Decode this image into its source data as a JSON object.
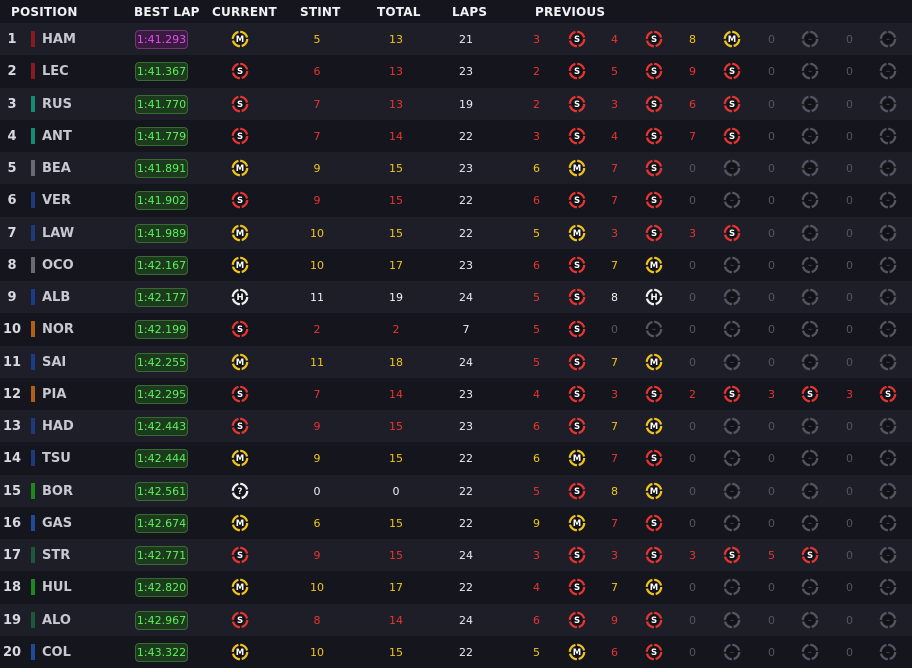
{
  "headers": {
    "position": "POSITION",
    "best_lap": "BEST LAP",
    "current": "CURRENT",
    "stint": "STINT",
    "total": "TOTAL",
    "laps": "LAPS",
    "previous": "PREVIOUS"
  },
  "colors": {
    "soft": "#e8342e",
    "medium": "#f0c419",
    "hard": "#f0f0f0",
    "unknown": "#f0f0f0",
    "empty": "#55555f",
    "lap_green": "#5cf05c",
    "lap_purple": "#e050e8"
  },
  "tyre_letters": {
    "soft": "S",
    "medium": "M",
    "hard": "H",
    "unknown": "?",
    "empty": "–"
  },
  "rows": [
    {
      "pos": "1",
      "driver": "HAM",
      "team_color": "#8a1a22",
      "best_lap": "1:41.293",
      "purple": true,
      "current": "medium",
      "stint": "5",
      "total": "13",
      "laps": "21",
      "stint_color": "medium",
      "previous": [
        [
          "3",
          "soft"
        ],
        [
          "4",
          "soft"
        ],
        [
          "8",
          "medium"
        ],
        [
          "0",
          "empty"
        ],
        [
          "0",
          "empty"
        ]
      ]
    },
    {
      "pos": "2",
      "driver": "LEC",
      "team_color": "#8a1a22",
      "best_lap": "1:41.367",
      "purple": false,
      "current": "soft",
      "stint": "6",
      "total": "13",
      "laps": "23",
      "stint_color": "soft",
      "previous": [
        [
          "2",
          "soft"
        ],
        [
          "5",
          "soft"
        ],
        [
          "9",
          "soft"
        ],
        [
          "0",
          "empty"
        ],
        [
          "0",
          "empty"
        ]
      ]
    },
    {
      "pos": "3",
      "driver": "RUS",
      "team_color": "#178a72",
      "best_lap": "1:41.770",
      "purple": false,
      "current": "soft",
      "stint": "7",
      "total": "13",
      "laps": "19",
      "stint_color": "soft",
      "previous": [
        [
          "2",
          "soft"
        ],
        [
          "3",
          "soft"
        ],
        [
          "6",
          "soft"
        ],
        [
          "0",
          "empty"
        ],
        [
          "0",
          "empty"
        ]
      ]
    },
    {
      "pos": "4",
      "driver": "ANT",
      "team_color": "#178a72",
      "best_lap": "1:41.779",
      "purple": false,
      "current": "soft",
      "stint": "7",
      "total": "14",
      "laps": "22",
      "stint_color": "soft",
      "previous": [
        [
          "3",
          "soft"
        ],
        [
          "4",
          "soft"
        ],
        [
          "7",
          "soft"
        ],
        [
          "0",
          "empty"
        ],
        [
          "0",
          "empty"
        ]
      ]
    },
    {
      "pos": "5",
      "driver": "BEA",
      "team_color": "#6a6a72",
      "best_lap": "1:41.891",
      "purple": false,
      "current": "medium",
      "stint": "9",
      "total": "15",
      "laps": "23",
      "stint_color": "medium",
      "previous": [
        [
          "6",
          "medium"
        ],
        [
          "7",
          "soft"
        ],
        [
          "0",
          "empty"
        ],
        [
          "0",
          "empty"
        ],
        [
          "0",
          "empty"
        ]
      ]
    },
    {
      "pos": "6",
      "driver": "VER",
      "team_color": "#1e3a7a",
      "best_lap": "1:41.902",
      "purple": false,
      "current": "soft",
      "stint": "9",
      "total": "15",
      "laps": "22",
      "stint_color": "soft",
      "previous": [
        [
          "6",
          "soft"
        ],
        [
          "7",
          "soft"
        ],
        [
          "0",
          "empty"
        ],
        [
          "0",
          "empty"
        ],
        [
          "0",
          "empty"
        ]
      ]
    },
    {
      "pos": "7",
      "driver": "LAW",
      "team_color": "#1e3a7a",
      "best_lap": "1:41.989",
      "purple": false,
      "current": "medium",
      "stint": "10",
      "total": "15",
      "laps": "22",
      "stint_color": "medium",
      "previous": [
        [
          "5",
          "medium"
        ],
        [
          "3",
          "soft"
        ],
        [
          "3",
          "soft"
        ],
        [
          "0",
          "empty"
        ],
        [
          "0",
          "empty"
        ]
      ]
    },
    {
      "pos": "8",
      "driver": "OCO",
      "team_color": "#6a6a72",
      "best_lap": "1:42.167",
      "purple": false,
      "current": "medium",
      "stint": "10",
      "total": "17",
      "laps": "23",
      "stint_color": "medium",
      "previous": [
        [
          "6",
          "soft"
        ],
        [
          "7",
          "medium"
        ],
        [
          "0",
          "empty"
        ],
        [
          "0",
          "empty"
        ],
        [
          "0",
          "empty"
        ]
      ]
    },
    {
      "pos": "9",
      "driver": "ALB",
      "team_color": "#1a3a8a",
      "best_lap": "1:42.177",
      "purple": false,
      "current": "hard",
      "stint": "11",
      "total": "19",
      "laps": "24",
      "stint_color": "hard",
      "previous": [
        [
          "5",
          "soft"
        ],
        [
          "8",
          "hard"
        ],
        [
          "0",
          "empty"
        ],
        [
          "0",
          "empty"
        ],
        [
          "0",
          "empty"
        ]
      ]
    },
    {
      "pos": "10",
      "driver": "NOR",
      "team_color": "#b06010",
      "best_lap": "1:42.199",
      "purple": false,
      "current": "soft",
      "stint": "2",
      "total": "2",
      "laps": "7",
      "stint_color": "soft",
      "previous": [
        [
          "5",
          "soft"
        ],
        [
          "0",
          "empty"
        ],
        [
          "0",
          "empty"
        ],
        [
          "0",
          "empty"
        ],
        [
          "0",
          "empty"
        ]
      ]
    },
    {
      "pos": "11",
      "driver": "SAI",
      "team_color": "#1a3a8a",
      "best_lap": "1:42.255",
      "purple": false,
      "current": "medium",
      "stint": "11",
      "total": "18",
      "laps": "24",
      "stint_color": "medium",
      "previous": [
        [
          "5",
          "soft"
        ],
        [
          "7",
          "medium"
        ],
        [
          "0",
          "empty"
        ],
        [
          "0",
          "empty"
        ],
        [
          "0",
          "empty"
        ]
      ]
    },
    {
      "pos": "12",
      "driver": "PIA",
      "team_color": "#b06010",
      "best_lap": "1:42.295",
      "purple": false,
      "current": "soft",
      "stint": "7",
      "total": "14",
      "laps": "23",
      "stint_color": "soft",
      "previous": [
        [
          "4",
          "soft"
        ],
        [
          "3",
          "soft"
        ],
        [
          "2",
          "soft"
        ],
        [
          "3",
          "soft"
        ],
        [
          "3",
          "soft"
        ]
      ]
    },
    {
      "pos": "13",
      "driver": "HAD",
      "team_color": "#1e3a7a",
      "best_lap": "1:42.443",
      "purple": false,
      "current": "soft",
      "stint": "9",
      "total": "15",
      "laps": "23",
      "stint_color": "soft",
      "previous": [
        [
          "6",
          "soft"
        ],
        [
          "7",
          "medium"
        ],
        [
          "0",
          "empty"
        ],
        [
          "0",
          "empty"
        ],
        [
          "0",
          "empty"
        ]
      ]
    },
    {
      "pos": "14",
      "driver": "TSU",
      "team_color": "#1e3a7a",
      "best_lap": "1:42.444",
      "purple": false,
      "current": "medium",
      "stint": "9",
      "total": "15",
      "laps": "22",
      "stint_color": "medium",
      "previous": [
        [
          "6",
          "medium"
        ],
        [
          "7",
          "soft"
        ],
        [
          "0",
          "empty"
        ],
        [
          "0",
          "empty"
        ],
        [
          "0",
          "empty"
        ]
      ]
    },
    {
      "pos": "15",
      "driver": "BOR",
      "team_color": "#1a8a1a",
      "best_lap": "1:42.561",
      "purple": false,
      "current": "unknown",
      "stint": "0",
      "total": "0",
      "laps": "22",
      "stint_color": "hard",
      "previous": [
        [
          "5",
          "soft"
        ],
        [
          "8",
          "medium"
        ],
        [
          "0",
          "empty"
        ],
        [
          "0",
          "empty"
        ],
        [
          "0",
          "empty"
        ]
      ]
    },
    {
      "pos": "16",
      "driver": "GAS",
      "team_color": "#1e4a9a",
      "best_lap": "1:42.674",
      "purple": false,
      "current": "medium",
      "stint": "6",
      "total": "15",
      "laps": "22",
      "stint_color": "medium",
      "previous": [
        [
          "9",
          "medium"
        ],
        [
          "7",
          "soft"
        ],
        [
          "0",
          "empty"
        ],
        [
          "0",
          "empty"
        ],
        [
          "0",
          "empty"
        ]
      ]
    },
    {
      "pos": "17",
      "driver": "STR",
      "team_color": "#1a5a3a",
      "best_lap": "1:42.771",
      "purple": false,
      "current": "soft",
      "stint": "9",
      "total": "15",
      "laps": "24",
      "stint_color": "soft",
      "previous": [
        [
          "3",
          "soft"
        ],
        [
          "3",
          "soft"
        ],
        [
          "3",
          "soft"
        ],
        [
          "5",
          "soft"
        ],
        [
          "0",
          "empty"
        ]
      ]
    },
    {
      "pos": "18",
      "driver": "HUL",
      "team_color": "#1a8a1a",
      "best_lap": "1:42.820",
      "purple": false,
      "current": "medium",
      "stint": "10",
      "total": "17",
      "laps": "22",
      "stint_color": "medium",
      "previous": [
        [
          "4",
          "soft"
        ],
        [
          "7",
          "medium"
        ],
        [
          "0",
          "empty"
        ],
        [
          "0",
          "empty"
        ],
        [
          "0",
          "empty"
        ]
      ]
    },
    {
      "pos": "19",
      "driver": "ALO",
      "team_color": "#1a5a3a",
      "best_lap": "1:42.967",
      "purple": false,
      "current": "soft",
      "stint": "8",
      "total": "14",
      "laps": "24",
      "stint_color": "soft",
      "previous": [
        [
          "6",
          "soft"
        ],
        [
          "9",
          "soft"
        ],
        [
          "0",
          "empty"
        ],
        [
          "0",
          "empty"
        ],
        [
          "0",
          "empty"
        ]
      ]
    },
    {
      "pos": "20",
      "driver": "COL",
      "team_color": "#1e4a9a",
      "best_lap": "1:43.322",
      "purple": false,
      "current": "medium",
      "stint": "10",
      "total": "15",
      "laps": "22",
      "stint_color": "medium",
      "previous": [
        [
          "5",
          "medium"
        ],
        [
          "6",
          "soft"
        ],
        [
          "0",
          "empty"
        ],
        [
          "0",
          "empty"
        ],
        [
          "0",
          "empty"
        ]
      ]
    }
  ]
}
